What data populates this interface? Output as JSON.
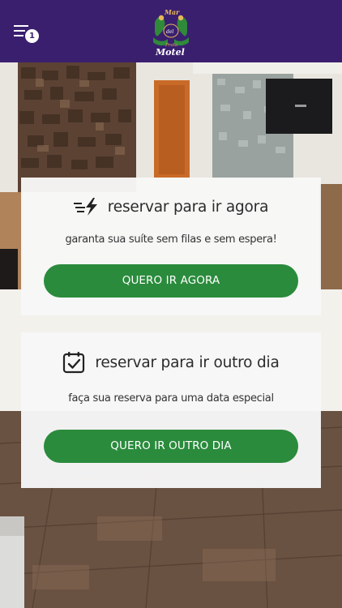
{
  "header": {
    "notification_count": "1",
    "logo_text_top": "Mar",
    "logo_text_mid": "del",
    "logo_text_prata": "Prata",
    "logo_text_bottom": "Motel"
  },
  "now_card": {
    "title": "reservar para ir agora",
    "subtitle": "garanta sua suíte sem filas e sem espera!",
    "button_label": "QUERO IR AGORA"
  },
  "later_card": {
    "title": "reservar para ir outro dia",
    "subtitle": "faça sua reserva para uma data especial",
    "button_label": "QUERO IR OUTRO DIA"
  },
  "colors": {
    "header_bg": "#3a1f6f",
    "button_green": "#2a8b3c",
    "card_bg": "#f7f7f7"
  },
  "icons": {
    "menu": "menu-lines-icon",
    "now": "fast-lightning-icon",
    "later": "calendar-check-icon"
  }
}
